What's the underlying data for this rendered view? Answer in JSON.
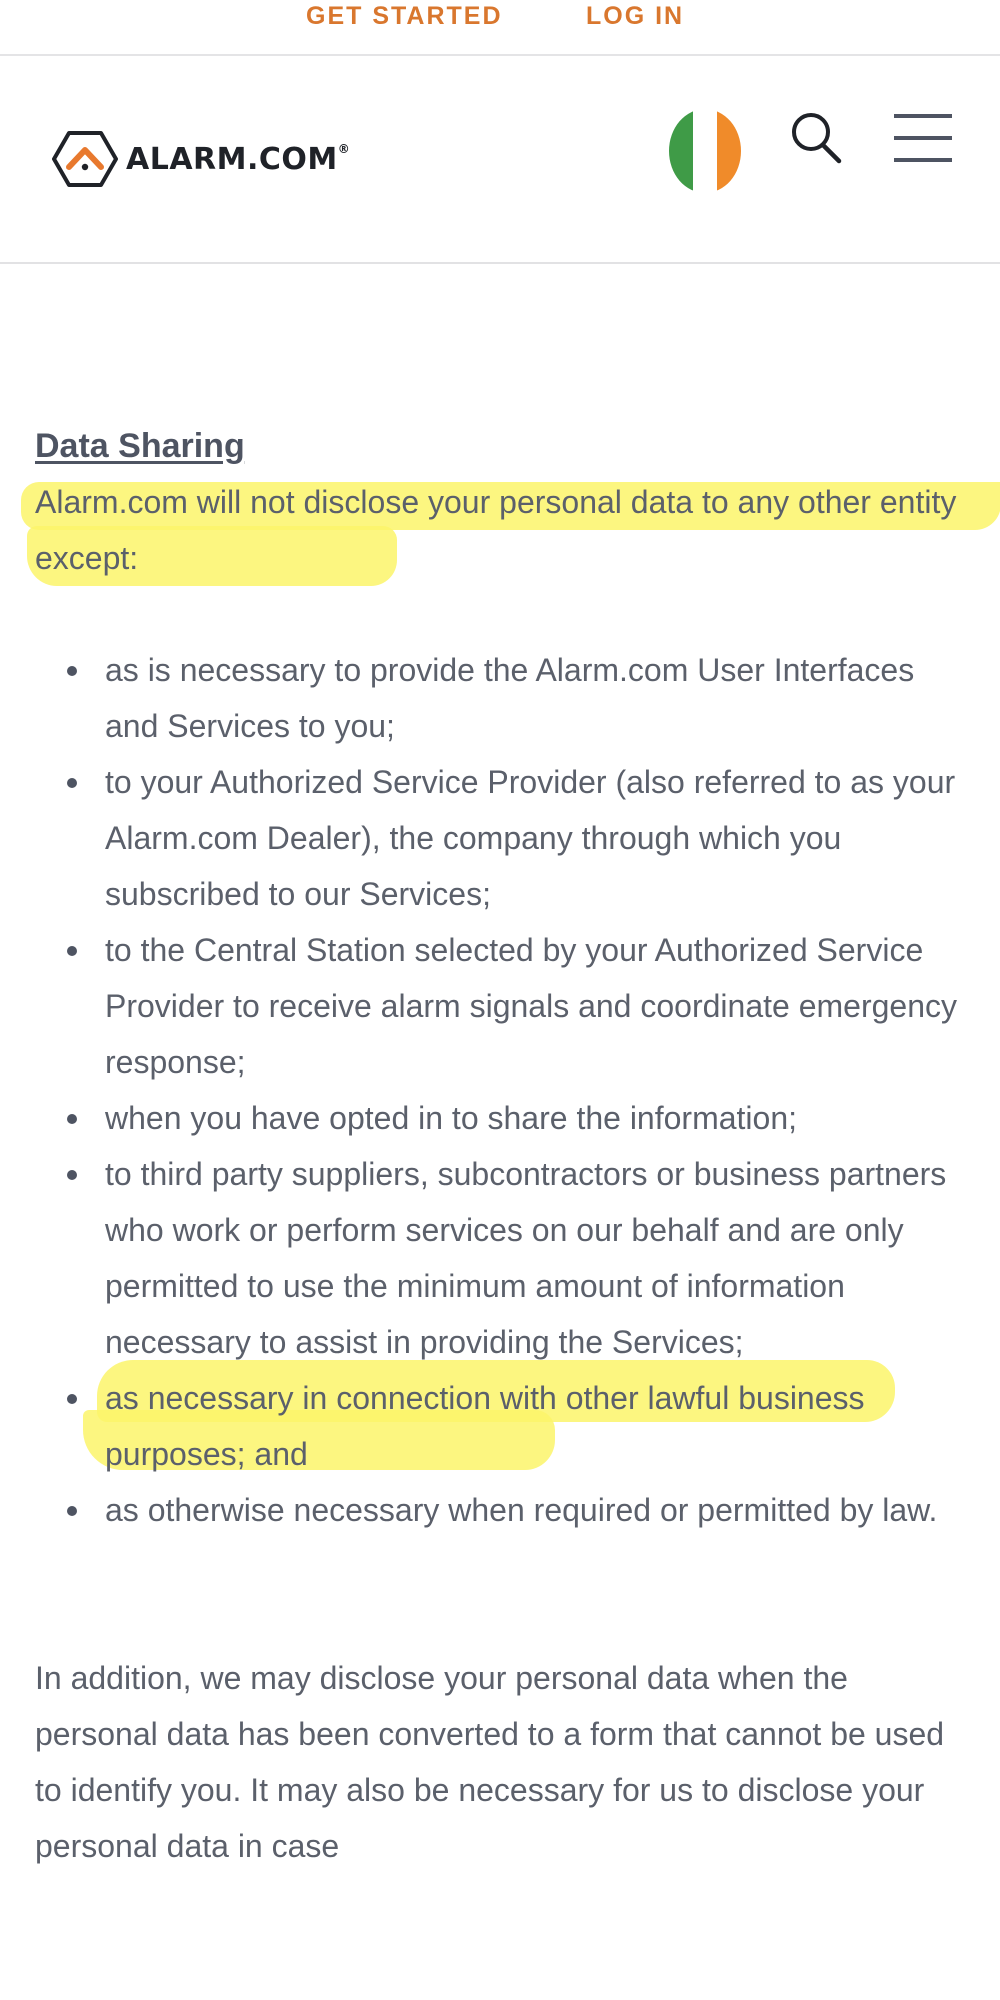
{
  "topbar": {
    "get_started": "GET STARTED",
    "log_in": "LOG IN"
  },
  "header": {
    "logo_text": "ALARM.COM",
    "logo_mark": "®"
  },
  "colors": {
    "accent": "#d9772e",
    "highlight": "#fbf56a",
    "flag_green": "#3f9b47",
    "flag_orange": "#f08b2a"
  },
  "icons": [
    "ireland-flag-icon",
    "search-icon",
    "hamburger-menu-icon"
  ],
  "section": {
    "title": "Data Sharing",
    "intro": "Alarm.com will not disclose your personal data to any other entity except:",
    "bullets": [
      "as is necessary to provide the Alarm.com User Interfaces and Services to you;",
      "to your Authorized Service Provider (also referred to as your Alarm.com Dealer), the company through which you subscribed to our Services;",
      "to the Central Station selected by your Authorized Service Provider to receive alarm signals and coordinate emergency response;",
      "when you have opted in to share the information;",
      "to third party suppliers, subcontractors or business partners who work or perform services on our behalf and are only permitted to use the minimum amount of information necessary to assist in providing the Services;",
      "as necessary in connection with other lawful business purposes; and",
      "as otherwise necessary when required or permitted by law."
    ],
    "addition": "In addition, we may disclose your personal data when the personal data has been converted to a form that cannot be used to identify you. It may also be necessary for us to disclose your personal data in case"
  }
}
